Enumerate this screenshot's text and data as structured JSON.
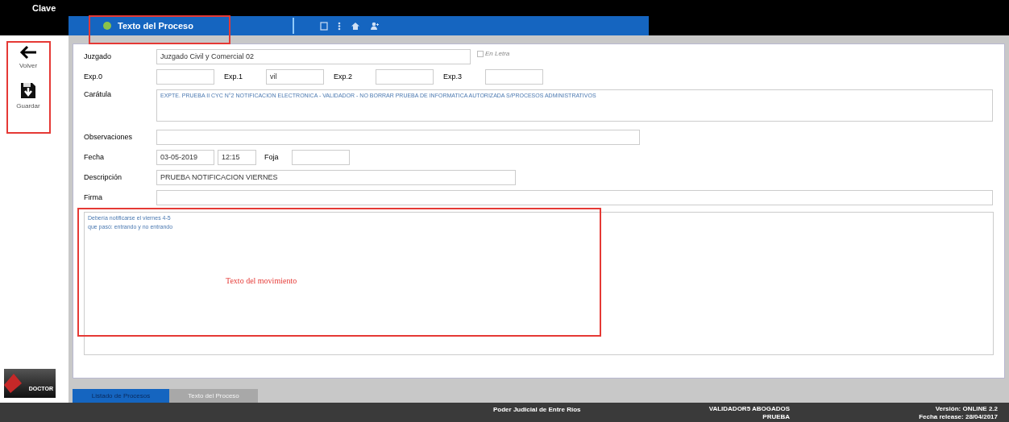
{
  "top_bar": {
    "title": "Clave"
  },
  "header": {
    "title": "Texto del Proceso",
    "toolbar_icons": [
      {
        "kind": "document"
      },
      {
        "kind": "more"
      },
      {
        "kind": "home"
      },
      {
        "kind": "user"
      }
    ]
  },
  "sidebar": {
    "items": [
      {
        "kind": "back",
        "label": "Volver"
      },
      {
        "kind": "save",
        "label": "Guardar"
      }
    ],
    "logo": "DOCTOR"
  },
  "form": {
    "juzgado": {
      "label": "Juzgado",
      "value": "Juzgado Civil y Comercial 02"
    },
    "en_letra": {
      "label": "En Letra",
      "checked": false
    },
    "exps": [
      {
        "label": "Exp.0"
      },
      {
        "label": "Exp.1",
        "value": "vil"
      },
      {
        "label": "Exp.2"
      },
      {
        "label": "Exp.3"
      }
    ],
    "caratula": {
      "label": "Carátula",
      "value": "EXPTE. PRUEBA II CYC N°2 NOTIFICACION ELECTRONICA - VALIDADOR - NO BORRAR PRUEBA DE INFORMATICA AUTORIZADA S/PROCESOS ADMINISTRATIVOS"
    },
    "observaciones": {
      "label": "Observaciones"
    },
    "fecha": {
      "label": "Fecha",
      "date": "03-05-2019",
      "time": "12:15"
    },
    "foja": {
      "label": "Foja"
    },
    "descripcion": {
      "label": "Descripción",
      "value": "PRUEBA NOTIFICACION VIERNES"
    },
    "firma": {
      "label": "Firma"
    },
    "texto": {
      "value": "Debería notificarse el viernes 4-5\nque pasó: entrando y no entrando"
    }
  },
  "annotations": {
    "texto_label": "Texto del movimiento"
  },
  "tabs": [
    {
      "label": "Listado de Procesos",
      "selected": true
    },
    {
      "label": "Texto del Proceso",
      "selected": false
    }
  ],
  "status_bar": {
    "organization": "Poder Judicial de Entre Ríos",
    "user": "VALIDADOR5 ABOGADOS",
    "user_line2": "PRUEBA",
    "version": "Versión: ONLINE 2.2",
    "release": "Fecha release: 28/04/2017"
  }
}
